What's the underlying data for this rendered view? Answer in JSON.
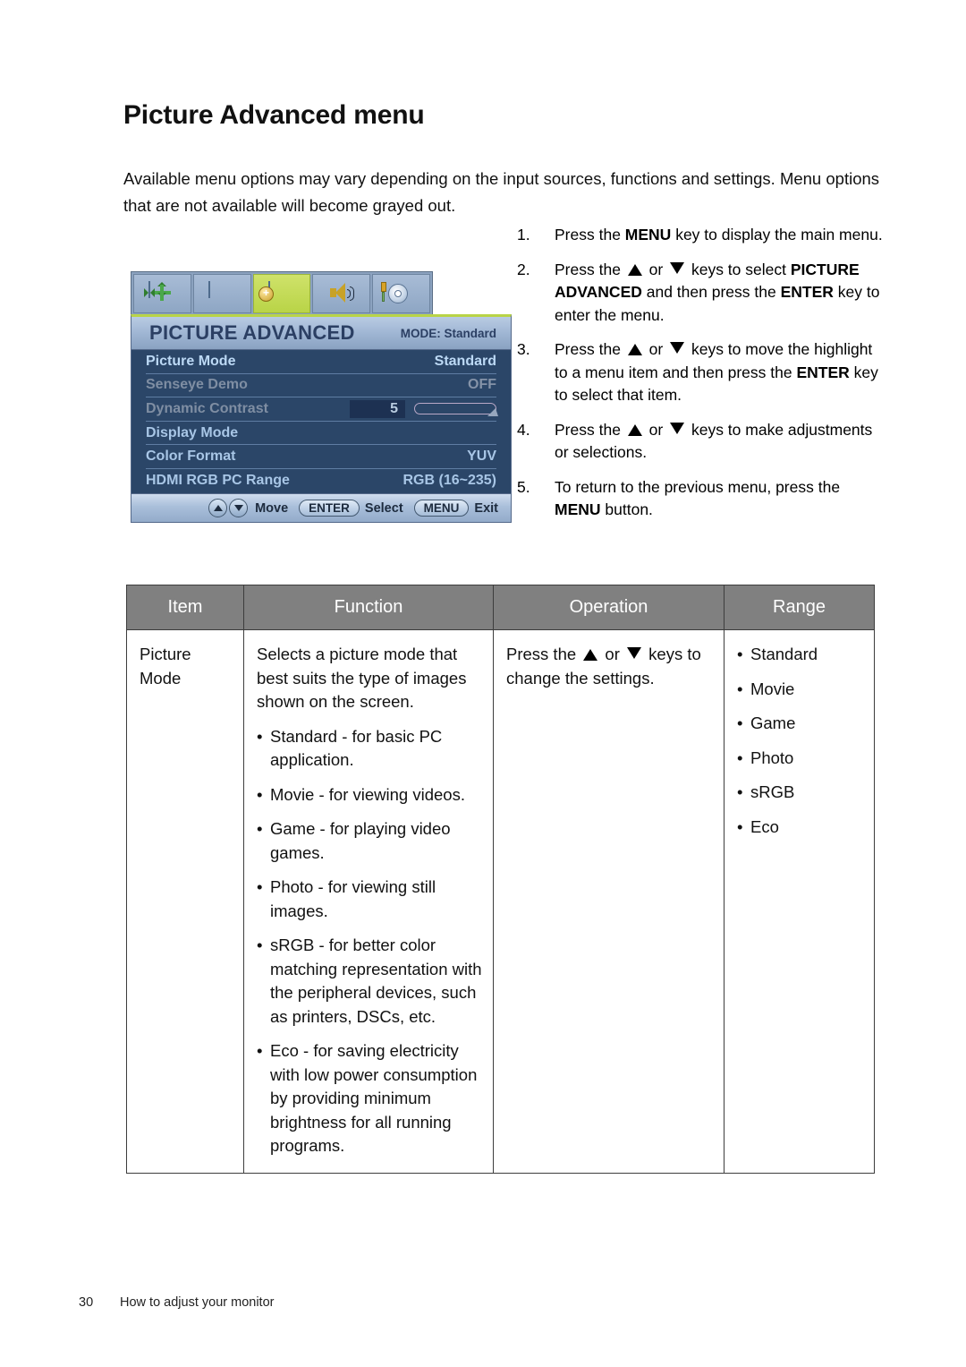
{
  "page": {
    "title": "Picture Advanced menu",
    "intro": "Available menu options may vary depending on the input sources, functions and settings. Menu options that are not available will become grayed out.",
    "footer_page_number": "30",
    "footer_text": "How to adjust your monitor"
  },
  "steps": [
    {
      "num": "1.",
      "text_before": "Press the ",
      "bold1": "MENU",
      "text_after": " key to display the main menu."
    },
    {
      "num": "2.",
      "text_after": ""
    },
    {
      "num": "3.",
      "text_after": ""
    },
    {
      "num": "4.",
      "text_after": ""
    },
    {
      "num": "5.",
      "text_after": ""
    }
  ],
  "instructions": {
    "step1": {
      "number": "1.",
      "part1": "Press the ",
      "key1": "MENU",
      "part2": " key to display the main menu."
    },
    "step2": {
      "number": "2.",
      "part1": "Press the ",
      "or": " or ",
      "part2": " keys to select ",
      "key1": "PICTURE ADVANCED",
      "part3": " and then press the ",
      "key2": "ENTER",
      "part4": " key to enter the menu."
    },
    "step3": {
      "number": "3.",
      "part1": "Press the ",
      "or": " or ",
      "part2": " keys to move the highlight to a menu item and then press the ",
      "key1": "ENTER",
      "part3": " key to select that item."
    },
    "step4": {
      "number": "4.",
      "part1": "Press the ",
      "or": " or ",
      "part2": " keys to make adjustments or selections."
    },
    "step5": {
      "number": "5.",
      "part1": "To return to the previous menu, press the ",
      "key1": "MENU",
      "part2": " button."
    }
  },
  "osd": {
    "tabs": [
      {
        "name": "display-position-icon",
        "active": false
      },
      {
        "name": "picture-icon",
        "active": false
      },
      {
        "name": "picture-advanced-icon",
        "active": true
      },
      {
        "name": "audio-icon",
        "active": false
      },
      {
        "name": "system-icon",
        "active": false
      }
    ],
    "title": "PICTURE ADVANCED",
    "mode_label": "MODE: Standard",
    "rows": [
      {
        "label": "Picture Mode",
        "value": "Standard",
        "state": "highlight"
      },
      {
        "label": "Senseye Demo",
        "value": "OFF",
        "state": "disabled"
      },
      {
        "label": "Dynamic Contrast",
        "value": "5",
        "state": "slider"
      },
      {
        "label": "Display Mode",
        "value": "",
        "state": "normal"
      },
      {
        "label": "Color Format",
        "value": "YUV",
        "state": "normal"
      },
      {
        "label": "HDMI RGB PC Range",
        "value": "RGB (16~235)",
        "state": "normal"
      }
    ],
    "footer": {
      "move_label": "Move",
      "enter_key": "ENTER",
      "select_label": "Select",
      "menu_key": "MENU",
      "exit_label": "Exit"
    },
    "colors": {
      "body_bg": "#2b4668",
      "title_bg": "#9db4d2",
      "active_tab": "#b9d447",
      "label": "#a8c6e6",
      "disabled": "#7f8ea3"
    }
  },
  "table": {
    "headers": [
      "Item",
      "Function",
      "Operation",
      "Range"
    ],
    "rows": [
      {
        "item": "Picture Mode",
        "function_lead": "Selects a picture mode that best suits the type of images shown on the screen.",
        "function_bullets": [
          "Standard - for basic PC application.",
          "Movie - for viewing videos.",
          "Game - for playing video games.",
          "Photo - for viewing still images.",
          "sRGB - for better color matching representation with the peripheral devices, such as printers, DSCs, etc.",
          "Eco - for saving electricity with low power consumption by providing minimum brightness for all running programs."
        ],
        "operation_part1": "Press the ",
        "operation_or": " or ",
        "operation_part2": " keys to change the settings.",
        "range": [
          "Standard",
          "Movie",
          "Game",
          "Photo",
          "sRGB",
          "Eco"
        ]
      }
    ]
  }
}
